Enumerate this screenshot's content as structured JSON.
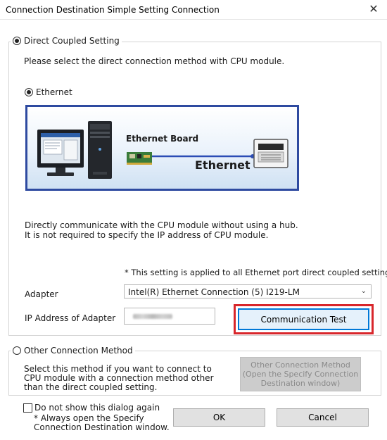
{
  "window": {
    "title": "Connection Destination Simple Setting Connection",
    "close_glyph": "✕"
  },
  "direct": {
    "label": "Direct Coupled Setting",
    "instruction": "Please select the direct connection method with CPU module.",
    "ethernet_label": "Ethernet",
    "diagram": {
      "board_label": "Ethernet Board",
      "network_label": "Ethernet"
    },
    "description_line1": "Directly communicate with the CPU module without using a hub.",
    "description_line2": "It is not required to specify the IP address of CPU module.",
    "note": "* This setting is applied to all Ethernet port direct coupled settings.",
    "adapter_label": "Adapter",
    "adapter_value": "Intel(R) Ethernet Connection (5) I219-LM",
    "ip_label": "IP Address of Adapter",
    "comm_test_label": "Communication Test"
  },
  "other": {
    "label": "Other Connection Method",
    "description_line1": "Select this method if you want to connect to",
    "description_line2": "CPU module with a connection method other",
    "description_line3": "than the direct coupled setting.",
    "button_line1": "Other Connection Method",
    "button_line2": "(Open the Specify Connection",
    "button_line3": "Destination window)"
  },
  "footer": {
    "checkbox_label": "Do not show this dialog again",
    "checkbox_note_line1": "* Always open the Specify",
    "checkbox_note_line2": "Connection Destination window.",
    "ok_label": "OK",
    "cancel_label": "Cancel"
  },
  "colors": {
    "diagram_border": "#2e4aa0",
    "highlight": "#d8262b",
    "focus_border": "#0078d7",
    "network_line": "#2c4db5"
  },
  "icons": {
    "close": "close-icon",
    "dropdown": "chevron-down-icon",
    "pc": "desktop-computer-icon",
    "plc": "plc-module-icon",
    "board": "ethernet-board-icon"
  }
}
